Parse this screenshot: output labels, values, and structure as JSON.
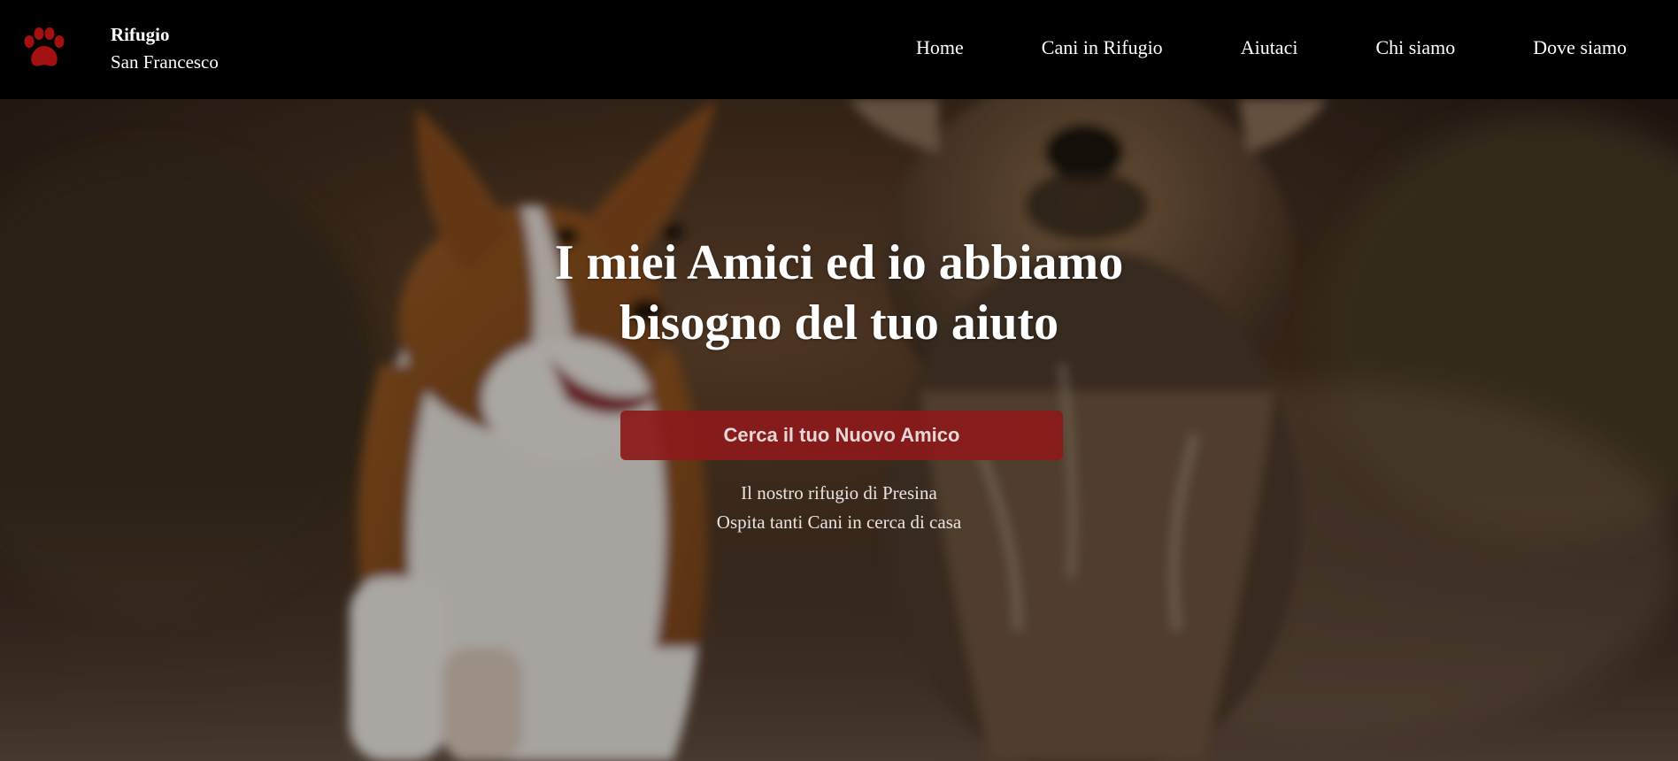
{
  "navbar": {
    "logo_icon": "paw-icon",
    "logo_color": "#a31010",
    "brand_title": "Rifugio",
    "brand_subtitle": "San Francesco",
    "links": [
      {
        "label": "Home"
      },
      {
        "label": "Cani in Rifugio"
      },
      {
        "label": "Aiutaci"
      },
      {
        "label": "Chi siamo"
      },
      {
        "label": "Dove siamo"
      }
    ]
  },
  "hero": {
    "background_image": "two-dogs-running-photo",
    "heading_line1": "I miei Amici ed io abbiamo",
    "heading_line2": "bisogno del tuo aiuto",
    "cta_label": "Cerca il tuo Nuovo Amico",
    "cta_color": "#8b1a1a",
    "sub_line1": "Il nostro rifugio di Presina",
    "sub_line2": "Ospita tanti Cani in cerca di casa"
  }
}
